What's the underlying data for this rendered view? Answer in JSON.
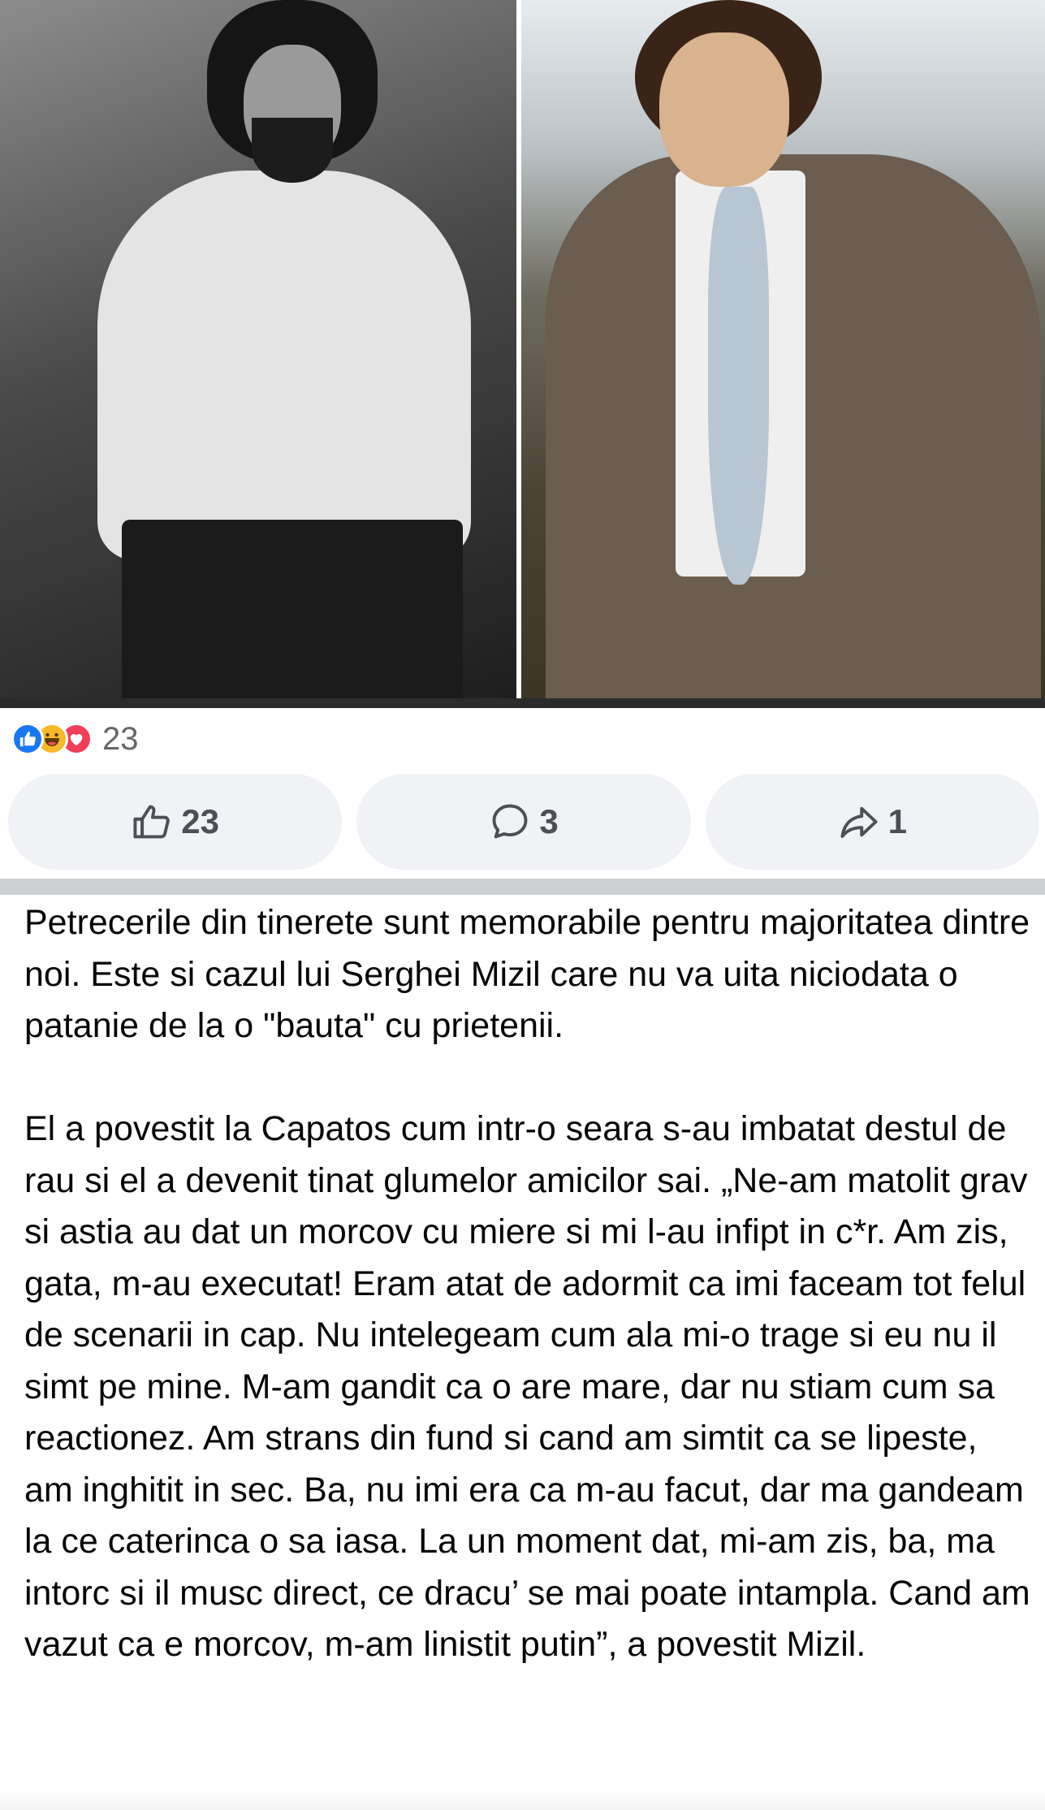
{
  "post": {
    "reactions": {
      "icons": [
        "like-icon",
        "haha-icon",
        "love-icon"
      ],
      "count": "23"
    },
    "actions": {
      "like_count": "23",
      "comment_count": "3",
      "share_count": "1"
    },
    "paragraphs": [
      "Petrecerile din tinerete sunt memorabile pentru majoritatea dintre noi. Este si cazul lui Serghei Mizil care nu va uita niciodata o patanie de la o \"bauta\" cu prietenii.",
      "El a povestit la Capatos cum intr-o seara s-au imbatat destul de rau si el a devenit tinat glumelor amicilor sai. „Ne-am matolit grav si astia au dat un morcov cu miere si mi l-au infipt in c*r. Am zis, gata, m-au executat! Eram atat de adormit ca imi faceam tot felul de scenarii in cap. Nu intelegeam cum ala mi-o trage si eu nu il simt pe mine. M-am gandit ca o are mare, dar nu stiam cum sa reactionez. Am strans din fund si cand am simtit ca se lipeste, am inghitit in sec. Ba, nu imi era ca m-au facut, dar ma gandeam la ce caterinca o sa iasa. La un moment dat, mi-am zis, ba, ma intorc si il musc direct, ce dracu’ se mai poate intampla. Cand am vazut ca e morcov, m-am linistit putin”, a povestit Mizil."
    ]
  },
  "colors": {
    "like": "#1877f2",
    "haha": "#f7b928",
    "love": "#f33e58",
    "button_bg": "#f0f2f5",
    "secondary_text": "#65676b"
  }
}
